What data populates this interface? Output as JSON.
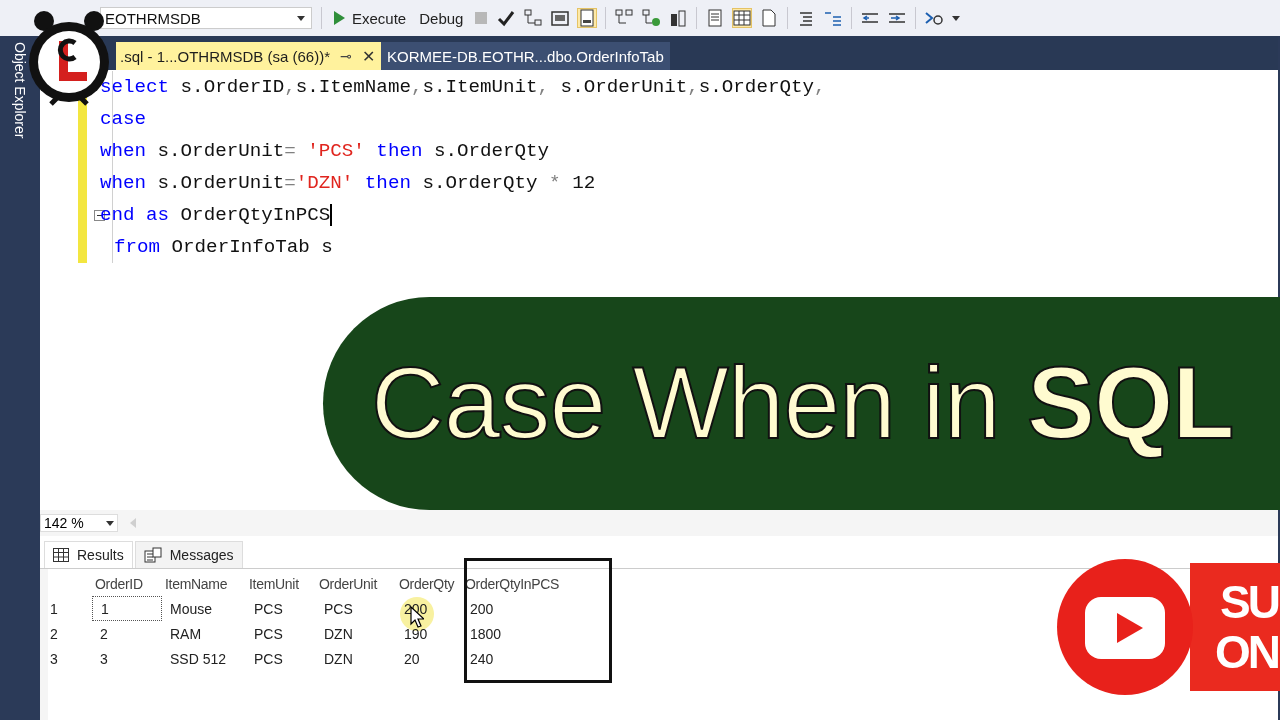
{
  "toolbar": {
    "database": "EOTHRMSDB",
    "execute": "Execute",
    "debug": "Debug"
  },
  "sidebar": {
    "label": "Object Explorer"
  },
  "tabs": [
    {
      "label": ".sql - 1...OTHRMSDB (sa (66))*",
      "selected": true,
      "pin": "⊸",
      "close": "✕"
    },
    {
      "label": "KORMEE-DB.EOTHR...dbo.OrderInfoTab",
      "selected": false
    }
  ],
  "editor": {
    "lines": [
      {
        "changed": true,
        "collapsible": false,
        "indented": false,
        "tokens": [
          {
            "kind": "keyword",
            "text": "select"
          },
          {
            "kind": "text",
            "text": " s.OrderID"
          },
          {
            "kind": "operator",
            "text": ","
          },
          {
            "kind": "text",
            "text": "s.ItemName"
          },
          {
            "kind": "operator",
            "text": ","
          },
          {
            "kind": "text",
            "text": "s.ItemUnit"
          },
          {
            "kind": "operator",
            "text": ","
          },
          {
            "kind": "text",
            "text": " s.OrderUnit"
          },
          {
            "kind": "operator",
            "text": ","
          },
          {
            "kind": "text",
            "text": "s.OrderQty"
          },
          {
            "kind": "operator",
            "text": ","
          }
        ]
      },
      {
        "changed": true,
        "collapsible": false,
        "indented": false,
        "tokens": [
          {
            "kind": "keyword",
            "text": "case"
          }
        ]
      },
      {
        "changed": true,
        "collapsible": false,
        "indented": false,
        "tokens": [
          {
            "kind": "keyword",
            "text": "when"
          },
          {
            "kind": "text",
            "text": " s.OrderUnit"
          },
          {
            "kind": "operator",
            "text": "="
          },
          {
            "kind": "string",
            "text": " 'PCS'"
          },
          {
            "kind": "keyword",
            "text": " then"
          },
          {
            "kind": "text",
            "text": " s.OrderQty"
          }
        ]
      },
      {
        "changed": true,
        "collapsible": false,
        "indented": false,
        "tokens": [
          {
            "kind": "keyword",
            "text": "when"
          },
          {
            "kind": "text",
            "text": " s.OrderUnit"
          },
          {
            "kind": "operator",
            "text": "="
          },
          {
            "kind": "string",
            "text": "'DZN'"
          },
          {
            "kind": "keyword",
            "text": " then"
          },
          {
            "kind": "text",
            "text": " s.OrderQty "
          },
          {
            "kind": "operator",
            "text": "*"
          },
          {
            "kind": "text",
            "text": " 12"
          }
        ]
      },
      {
        "changed": true,
        "collapsible": true,
        "indented": false,
        "caret": true,
        "tokens": [
          {
            "kind": "keyword",
            "text": "end"
          },
          {
            "kind": "keyword",
            "text": " as"
          },
          {
            "kind": "text",
            "text": " OrderQtyInPCS"
          }
        ]
      },
      {
        "changed": true,
        "collapsible": false,
        "indented": true,
        "tokens": [
          {
            "kind": "keyword",
            "text": "from"
          },
          {
            "kind": "text",
            "text": " OrderInfoTab s"
          }
        ]
      }
    ]
  },
  "banner": {
    "title": "Case When in **SQL**"
  },
  "zoom": {
    "value": "142 %"
  },
  "result_tabs": [
    {
      "label": "Results",
      "selected": true
    },
    {
      "label": "Messages",
      "selected": false
    }
  ],
  "grid": {
    "columns": [
      "OrderID",
      "ItemName",
      "ItemUnit",
      "OrderUnit",
      "OrderQty",
      "OrderQtyInPCS"
    ],
    "rows": [
      {
        "number": "1",
        "selected": true,
        "cells": [
          "1",
          "Mouse",
          "PCS",
          "PCS",
          "200",
          "200"
        ]
      },
      {
        "number": "2",
        "selected": false,
        "cells": [
          "2",
          "RAM",
          "PCS",
          "DZN",
          "190",
          "1800"
        ]
      },
      {
        "number": "3",
        "selected": false,
        "cells": [
          "3",
          "SSD 512",
          "PCS",
          "DZN",
          "20",
          "240"
        ]
      }
    ]
  },
  "subscribe": {
    "lines": [
      "SU",
      "ON"
    ]
  }
}
